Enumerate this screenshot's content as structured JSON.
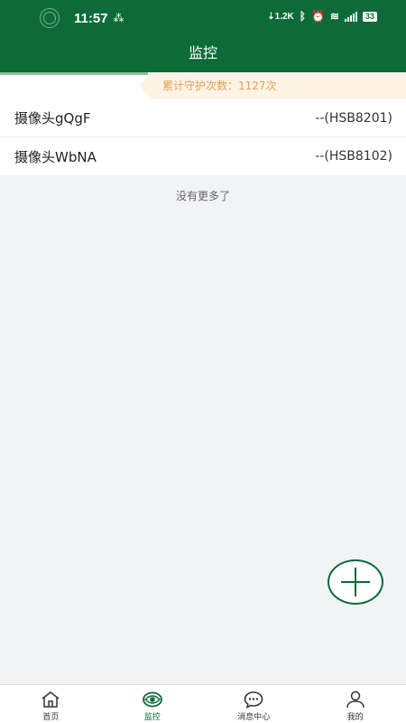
{
  "status_bar": {
    "time": "11:57",
    "net_speed": "1.2K",
    "battery": "33"
  },
  "header": {
    "title": "监控"
  },
  "stats": {
    "guard_count_text": "累计守护次数：1127次"
  },
  "devices": [
    {
      "name": "摄像头gQgF",
      "code": "--(HSB8201)"
    },
    {
      "name": "摄像头WbNA",
      "code": "--(HSB8102)"
    }
  ],
  "list_footer": "没有更多了",
  "tabs": [
    {
      "label": "首页",
      "icon": "home-icon",
      "active": false
    },
    {
      "label": "监控",
      "icon": "eye-icon",
      "active": true
    },
    {
      "label": "消息中心",
      "icon": "chat-icon",
      "active": false
    },
    {
      "label": "我的",
      "icon": "user-icon",
      "active": false
    }
  ],
  "colors": {
    "brand": "#0c6b38",
    "stats_text": "#e0a34c",
    "stats_bg": "#fff3e6"
  }
}
